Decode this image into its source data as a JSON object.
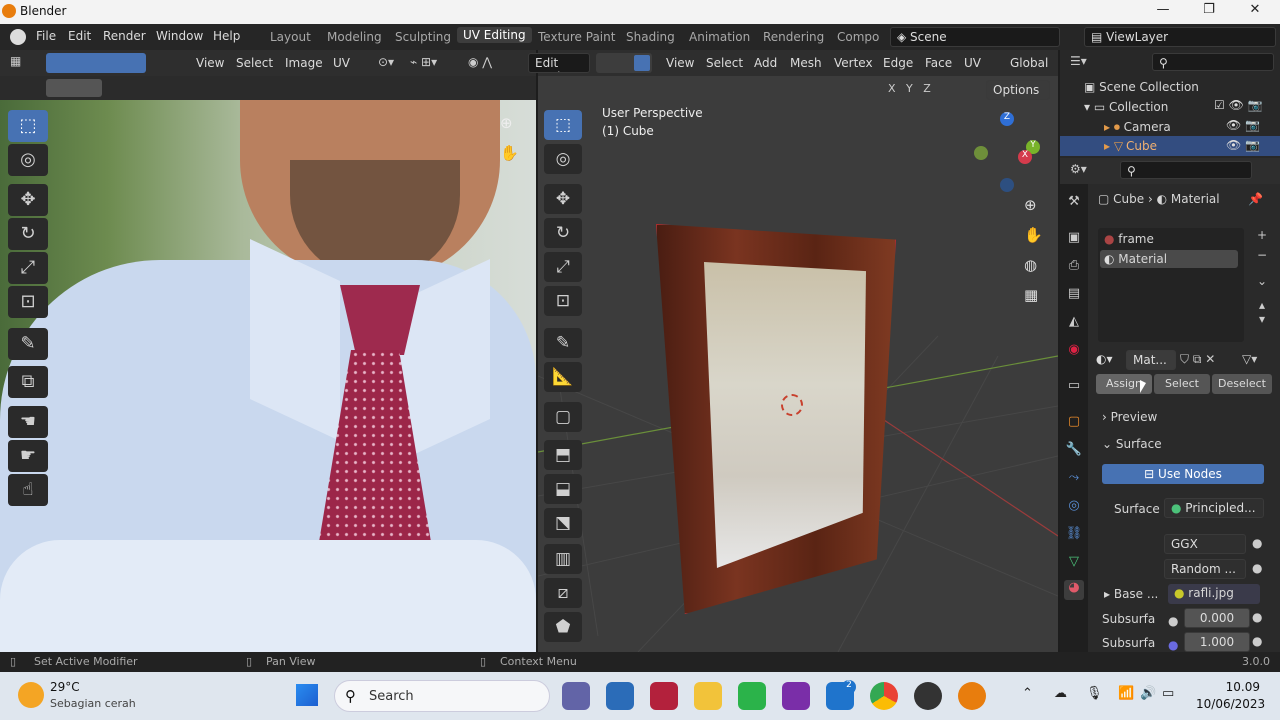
{
  "window": {
    "title": "Blender",
    "controls": [
      "—",
      "❐",
      "✕"
    ]
  },
  "menu": [
    "File",
    "Edit",
    "Render",
    "Window",
    "Help"
  ],
  "workspaces": [
    "Layout",
    "Modeling",
    "Sculpting",
    "UV Editing",
    "Texture Paint",
    "Shading",
    "Animation",
    "Rendering",
    "Compo"
  ],
  "active_workspace": "UV Editing",
  "scene_label": "Scene",
  "viewlayer_label": "ViewLayer",
  "uv_header": {
    "view": "View",
    "select": "Select",
    "image": "Image",
    "uv": "UV"
  },
  "viewport_header": {
    "mode": "Edit Mode",
    "view": "View",
    "select": "Select",
    "add": "Add",
    "mesh": "Mesh",
    "vertex": "Vertex",
    "edge": "Edge",
    "face": "Face",
    "uv": "UV",
    "orientation": "Global"
  },
  "viewport": {
    "perspective": "User Perspective",
    "object": "(1) Cube",
    "options": "Options",
    "axes": [
      "X",
      "Y",
      "Z"
    ]
  },
  "outliner": {
    "root": "Scene Collection",
    "collection": "Collection",
    "items": [
      {
        "name": "Camera"
      },
      {
        "name": "Cube"
      }
    ]
  },
  "properties": {
    "breadcrumb": {
      "object": "Cube",
      "tab": "Material"
    },
    "slots": [
      "frame",
      "Material"
    ],
    "material_field": "Mat...",
    "buttons": {
      "assign": "Assign",
      "select": "Select",
      "deselect": "Deselect"
    },
    "preview_panel": "Preview",
    "surface_panel": "Surface",
    "use_nodes": "Use Nodes",
    "surface_label": "Surface",
    "surface_value": "Principled...",
    "distribution": "GGX",
    "subsurface_method": "Random ...",
    "base_color_label": "Base ...",
    "base_color_value": "rafli.jpg",
    "subsurface1_label": "Subsurfa",
    "subsurface1_value": "0.000",
    "subsurface2_label": "Subsurfa",
    "subsurface2_value": "1.000"
  },
  "status": {
    "left": "Set Active Modifier",
    "middle": "Pan View",
    "right": "Context Menu",
    "version": "3.0.0"
  },
  "taskbar": {
    "temperature": "29°C",
    "weather": "Sebagian cerah",
    "search": "Search",
    "time": "10.09",
    "date": "10/06/2023",
    "badge": "2"
  },
  "colors": {
    "accent": "#4772b3",
    "blender_orange": "#e87d0d"
  }
}
